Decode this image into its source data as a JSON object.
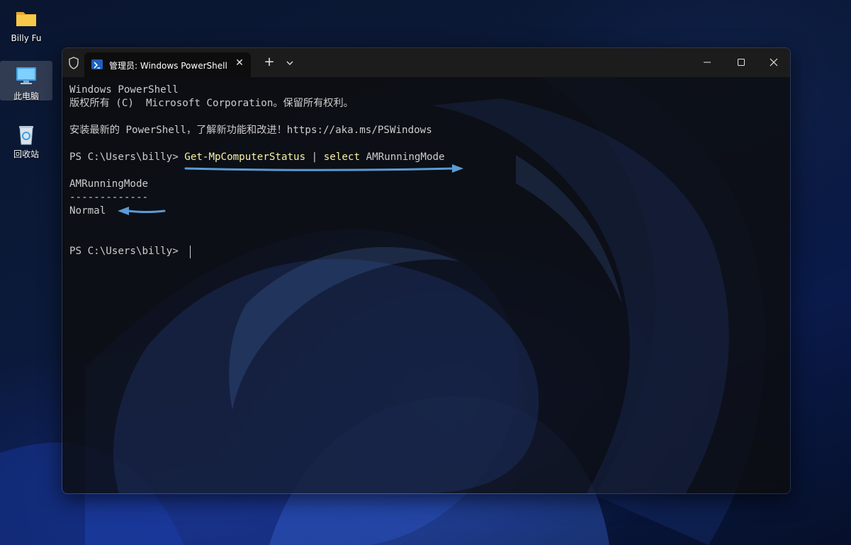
{
  "desktop": {
    "icons": [
      {
        "label": "Billy Fu",
        "icon": "folder-icon"
      },
      {
        "label": "此电脑",
        "icon": "computer-icon"
      },
      {
        "label": "回收站",
        "icon": "recycle-bin-icon"
      }
    ]
  },
  "terminal": {
    "tab_title": "管理员: Windows PowerShell",
    "lines": {
      "header1": "Windows PowerShell",
      "header2": "版权所有 (C)  Microsoft Corporation。保留所有权利。",
      "header3": "安装最新的 PowerShell，了解新功能和改进！https://aka.ms/PSWindows",
      "prompt1": "PS C:\\Users\\billy> ",
      "cmd_name": "Get-MpComputerStatus",
      "pipe": " | ",
      "cmd_select": "select",
      "cmd_arg": " AMRunningMode",
      "col_header": "AMRunningMode",
      "col_rule": "-------------",
      "col_value": "Normal",
      "prompt2": "PS C:\\Users\\billy> "
    },
    "colors": {
      "command": "#f9f1a5",
      "text": "#cccccc",
      "arrow": "#5b9bd5"
    }
  }
}
